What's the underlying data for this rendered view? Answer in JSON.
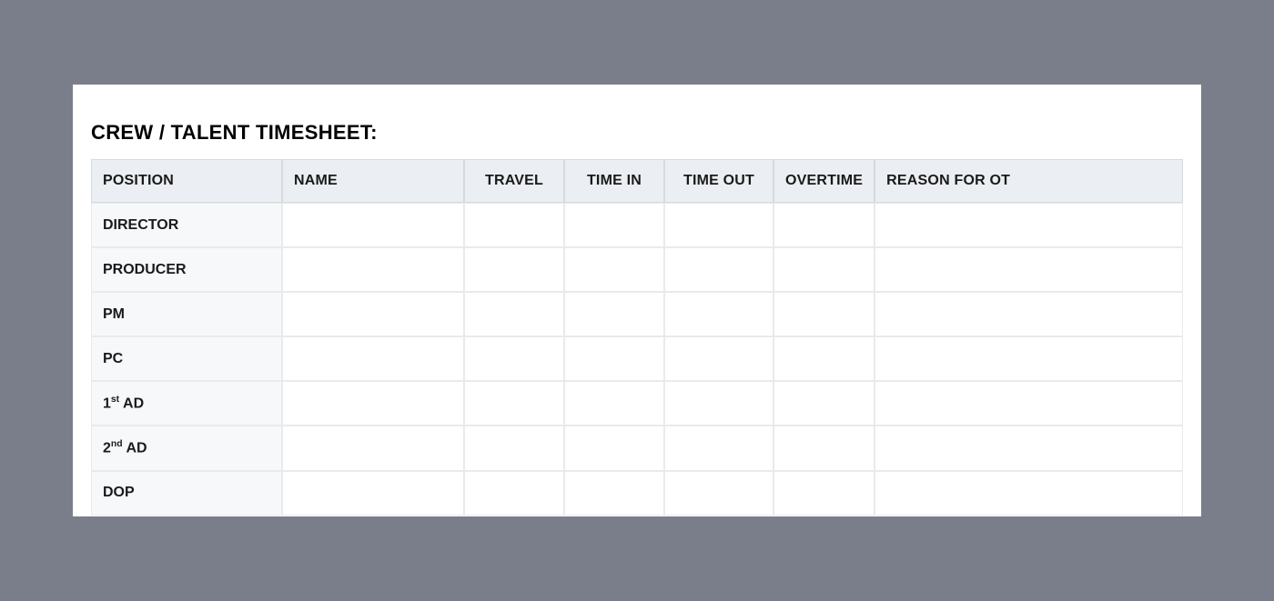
{
  "title": "CREW / TALENT TIMESHEET:",
  "headers": {
    "position": "POSITION",
    "name": "NAME",
    "travel": "TRAVEL",
    "time_in": "TIME IN",
    "time_out": "TIME OUT",
    "overtime": "OVERTIME",
    "reason": "REASON FOR OT"
  },
  "rows": [
    {
      "position": "DIRECTOR",
      "name": "",
      "travel": "",
      "time_in": "",
      "time_out": "",
      "overtime": "",
      "reason": ""
    },
    {
      "position": "PRODUCER",
      "name": "",
      "travel": "",
      "time_in": "",
      "time_out": "",
      "overtime": "",
      "reason": ""
    },
    {
      "position": "PM",
      "name": "",
      "travel": "",
      "time_in": "",
      "time_out": "",
      "overtime": "",
      "reason": ""
    },
    {
      "position": "PC",
      "name": "",
      "travel": "",
      "time_in": "",
      "time_out": "",
      "overtime": "",
      "reason": ""
    },
    {
      "position_prefix": "1",
      "position_ord": "st",
      "position_suffix": " AD",
      "name": "",
      "travel": "",
      "time_in": "",
      "time_out": "",
      "overtime": "",
      "reason": ""
    },
    {
      "position_prefix": "2",
      "position_ord": "nd",
      "position_suffix": " AD",
      "name": "",
      "travel": "",
      "time_in": "",
      "time_out": "",
      "overtime": "",
      "reason": ""
    },
    {
      "position": "DOP",
      "name": "",
      "travel": "",
      "time_in": "",
      "time_out": "",
      "overtime": "",
      "reason": ""
    }
  ]
}
